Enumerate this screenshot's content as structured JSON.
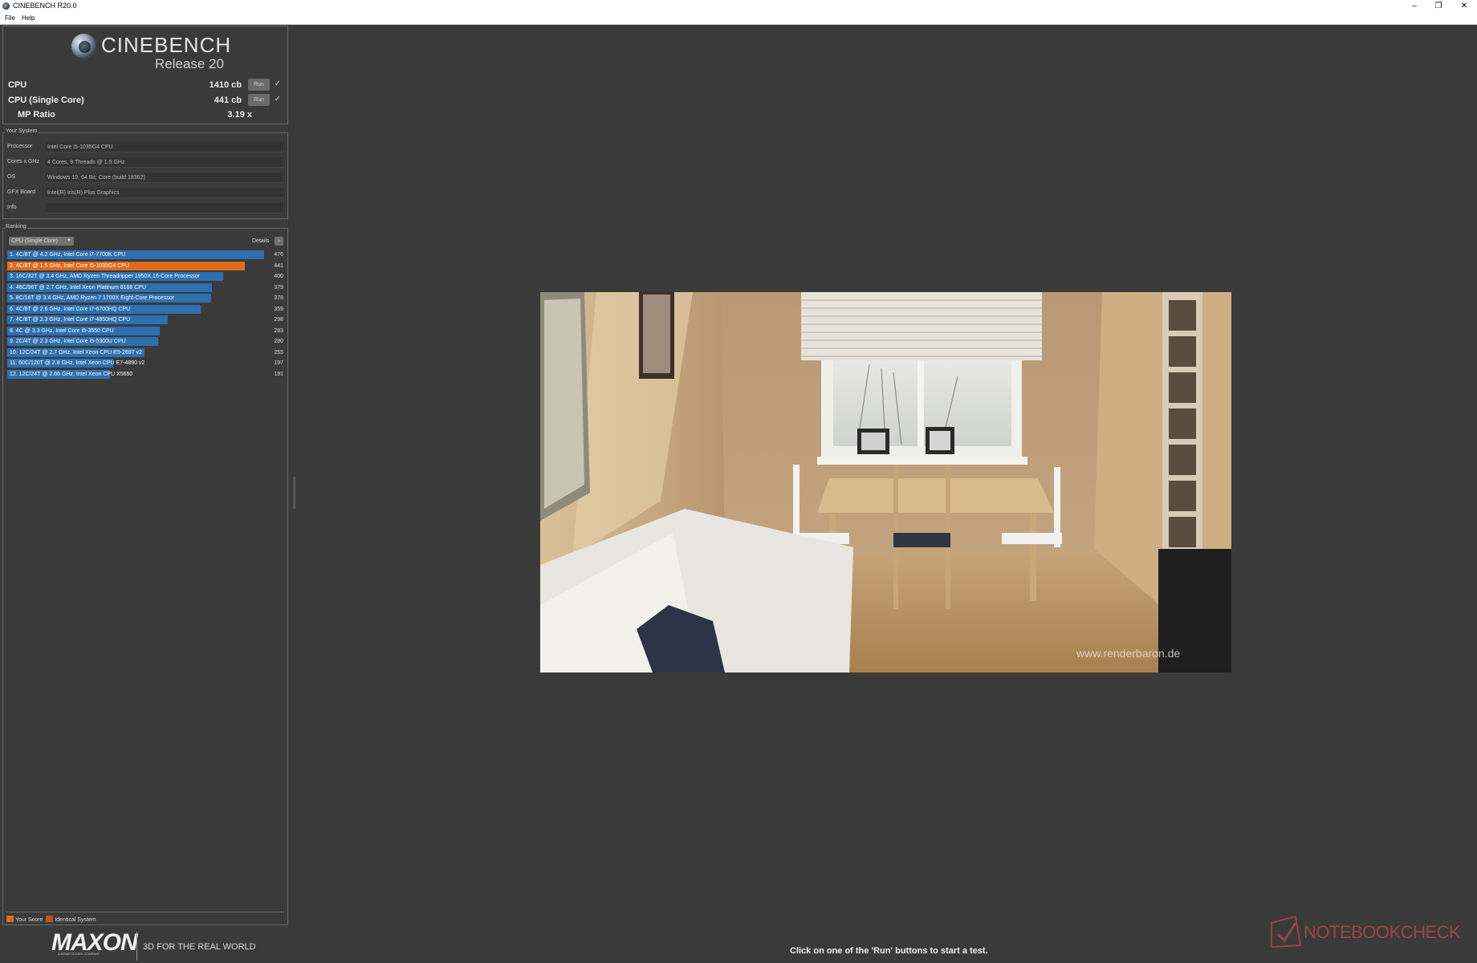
{
  "window": {
    "title": "CINEBENCH R20.0"
  },
  "menu": {
    "file": "File",
    "help": "Help"
  },
  "header": {
    "product": "CINEBENCH",
    "release": "Release 20"
  },
  "scores": {
    "cpu": {
      "label": "CPU",
      "value": "1410 cb",
      "run_label": "Run",
      "done": "✓"
    },
    "cpu_single": {
      "label": "CPU (Single Core)",
      "value": "441 cb",
      "run_label": "Run",
      "done": "✓"
    },
    "mp_ratio": {
      "label": "MP Ratio",
      "value": "3.19 x"
    }
  },
  "system": {
    "title": "Your System",
    "rows": [
      {
        "key": "Processor",
        "value": "Intel Core i5-1035G4 CPU"
      },
      {
        "key": "Cores x GHz",
        "value": "4 Cores, 8 Threads @ 1.5 GHz"
      },
      {
        "key": "OS",
        "value": "Windows 10, 64 Bit, Core (build 18362)"
      },
      {
        "key": "GFX Board",
        "value": "Intel(R) Iris(R) Plus Graphics"
      },
      {
        "key": "Info",
        "value": ""
      }
    ]
  },
  "ranking": {
    "title": "Ranking",
    "dropdown": "CPU (Single Core)",
    "details": "Details",
    "rows": [
      {
        "label": "1. 4C/8T @ 4.2 GHz, Intel Core i7-7700K CPU",
        "score": 476,
        "highlight": false
      },
      {
        "label": "2. 4C/8T @ 1.5 GHz, Intel Core i5-1035G4 CPU",
        "score": 441,
        "highlight": true
      },
      {
        "label": "3. 16C/32T @ 3.4 GHz, AMD Ryzen Threadripper 1950X 16-Core Processor",
        "score": 400,
        "highlight": false
      },
      {
        "label": "4. 48C/96T @ 2.7 GHz, Intel Xeon Platinum 8168 CPU",
        "score": 379,
        "highlight": false
      },
      {
        "label": "5. 8C/16T @ 3.4 GHz, AMD Ryzen 7 1700X Eight-Core Processor",
        "score": 378,
        "highlight": false
      },
      {
        "label": "6. 4C/8T @ 2.6 GHz, Intel Core i7-6700HQ CPU",
        "score": 359,
        "highlight": false
      },
      {
        "label": "7. 4C/8T @ 2.3 GHz, Intel Core i7-4850HQ CPU",
        "score": 298,
        "highlight": false
      },
      {
        "label": "8. 4C @ 3.3 GHz, Intel Core i5-3550 CPU",
        "score": 283,
        "highlight": false
      },
      {
        "label": "9. 2C/4T @ 2.3 GHz, Intel Core i5-5300U CPU",
        "score": 280,
        "highlight": false
      },
      {
        "label": "10. 12C/24T @ 2.7 GHz, Intel Xeon CPU E5-2697 v2",
        "score": 255,
        "highlight": false
      },
      {
        "label": "11. 60C/120T @ 2.8 GHz, Intel Xeon CPU E7-4890 v2",
        "score": 197,
        "highlight": false
      },
      {
        "label": "12. 12C/24T @ 2.66 GHz, Intel Xeon CPU X5650",
        "score": 191,
        "highlight": false
      }
    ],
    "legend": {
      "your_score": "Your Score",
      "identical": "Identical System"
    },
    "colors": {
      "bar": "#2e6fb0",
      "highlight": "#e06a1d",
      "identical": "#b8561c"
    }
  },
  "brand": {
    "logo": "MAXON",
    "sub": "A NEMETSCHEK COMPANY",
    "tagline": "3D FOR THE REAL WORLD"
  },
  "render": {
    "watermark": "www.renderbaron.de"
  },
  "status": "Click on one of the 'Run' buttons to start a test.",
  "overlay": {
    "watermark": "NOTEBOOKCHECK"
  }
}
